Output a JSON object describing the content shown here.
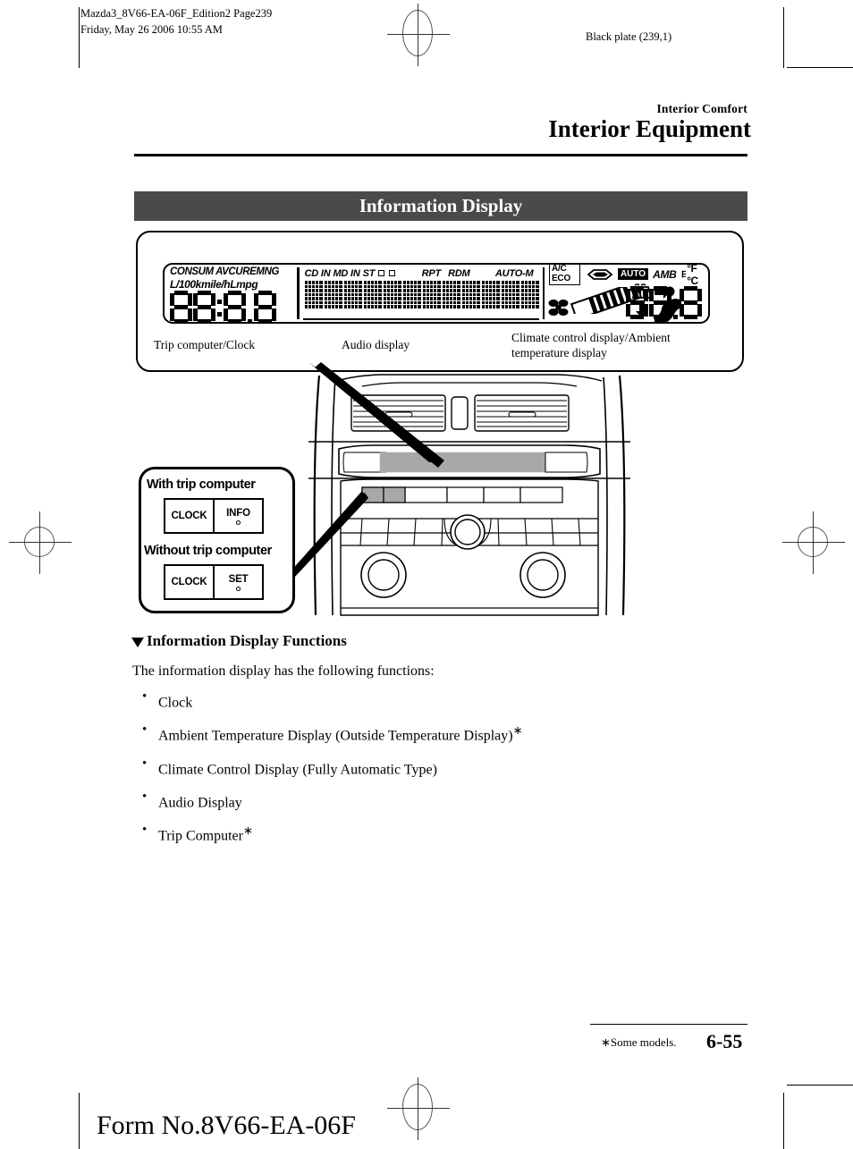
{
  "print_meta": {
    "file_line": "Mazda3_8V66-EA-06F_Edition2 Page239",
    "date_line": "Friday, May 26 2006 10:55 AM",
    "plate": "Black plate (239,1)"
  },
  "chapter": {
    "subtitle": "Interior Comfort",
    "title": "Interior Equipment"
  },
  "section": {
    "banner_title": "Information Display"
  },
  "lcd": {
    "trip": {
      "label_row1": "CONSUM AVCUREMNG",
      "label_row2": "L/100kmile/hLmpg",
      "digits": "88:8.8"
    },
    "audio": {
      "indicators": [
        "CD IN",
        "MD IN",
        "ST"
      ],
      "square_boxes": 2,
      "right_indicators": [
        "RPT",
        "RDM"
      ],
      "auto_m": "AUTO-M",
      "matrix_cells": 12
    },
    "climate": {
      "ac_eco": "A/C ECO",
      "auto": "AUTO",
      "amb": "AMB",
      "units": "°F °C",
      "digits": "88.8",
      "icons": [
        "recirculation-car-icon",
        "fan-icon",
        "airflow-bars-icon",
        "defroster-icon",
        "arrow-right-icon",
        "arrow-down-icon",
        "seat-person-icon",
        "thermometer-icon"
      ]
    }
  },
  "captions": {
    "trip": "Trip computer/Clock",
    "audio": "Audio display",
    "climate_line1": "Climate control display/Ambient",
    "climate_line2": "temperature display"
  },
  "button_callout": {
    "with_title": "With trip computer",
    "with_buttons": [
      "CLOCK",
      "INFO"
    ],
    "without_title": "Without trip computer",
    "without_buttons": [
      "CLOCK",
      "SET"
    ]
  },
  "body": {
    "subheading": "Information Display Functions",
    "intro": "The information display has the following functions:",
    "bullets": [
      {
        "text": "Clock",
        "star": ""
      },
      {
        "text": "Ambient Temperature Display (Outside Temperature Display)",
        "star": "∗"
      },
      {
        "text": "Climate Control Display (Fully Automatic Type)",
        "star": ""
      },
      {
        "text": "Audio Display",
        "star": ""
      },
      {
        "text": "Trip Computer",
        "star": "∗"
      }
    ]
  },
  "footer": {
    "note": "∗Some models.",
    "page_number": "6-55",
    "form_number": "Form No.8V66-EA-06F"
  },
  "colors": {
    "banner_bg": "#4a4a4a",
    "banner_text": "#ffffff",
    "highlight_gray": "#a8a8a8"
  }
}
